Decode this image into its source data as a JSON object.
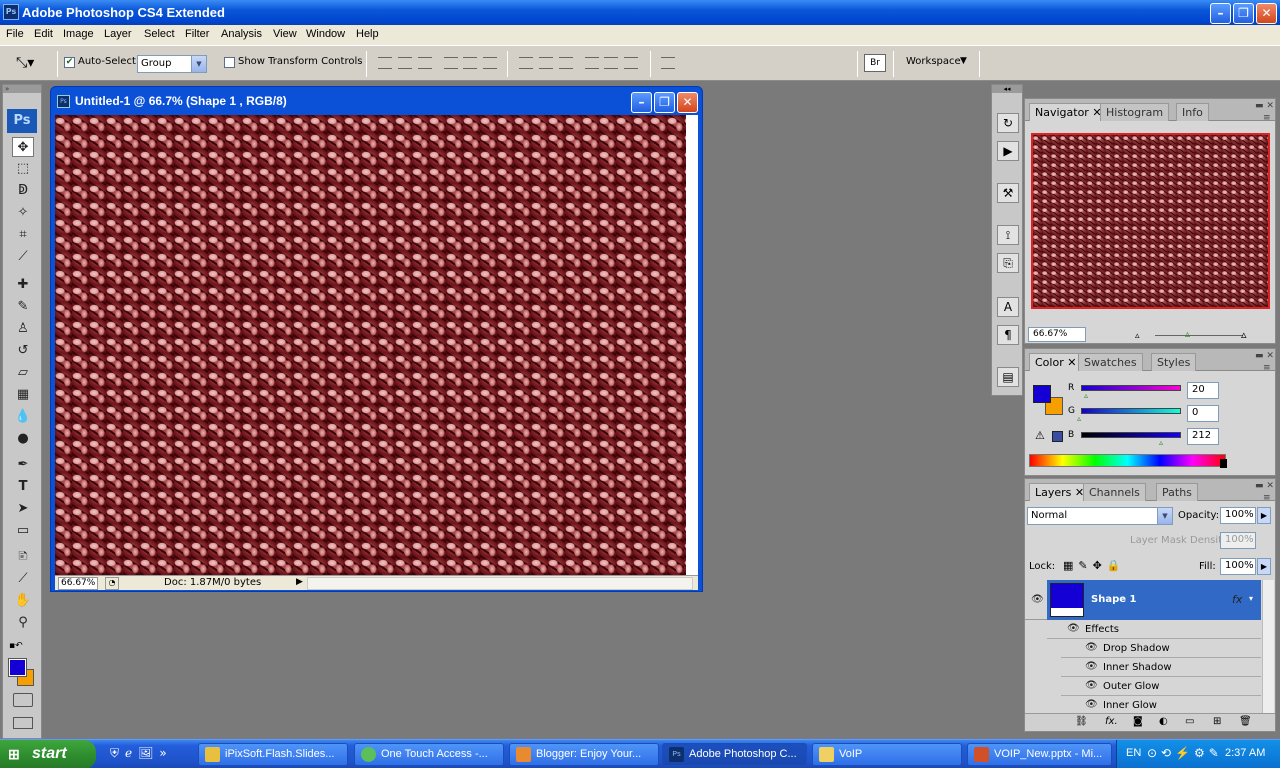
{
  "window": {
    "title": "Adobe Photoshop CS4 Extended",
    "app_icon": "Ps"
  },
  "menu": [
    "File",
    "Edit",
    "Image",
    "Layer",
    "Select",
    "Filter",
    "Analysis",
    "View",
    "Window",
    "Help"
  ],
  "options": {
    "auto_select_label": "Auto-Select:",
    "auto_select_checked": true,
    "auto_select_value": "Group",
    "transform_label": "Show Transform Controls",
    "transform_checked": false,
    "workspace_label": "Workspace"
  },
  "toolbox": {
    "logo": "Ps",
    "tools": [
      "move-tool",
      "marquee-tool",
      "lasso-tool",
      "magic-wand-tool",
      "crop-tool",
      "eyedropper-tool",
      "healing-brush-tool",
      "brush-tool",
      "clone-stamp-tool",
      "history-brush-tool",
      "eraser-tool",
      "gradient-tool",
      "blur-tool",
      "dodge-tool",
      "pen-tool",
      "type-tool",
      "path-selection-tool",
      "shape-tool",
      "notes-tool",
      "eyedropper-3d-tool",
      "hand-tool",
      "zoom-tool"
    ]
  },
  "document": {
    "title": "Untitled-1 @ 66.7% (Shape 1 , RGB/8)",
    "zoom": "66.67%",
    "doc_info": "Doc: 1.87M/0 bytes"
  },
  "navigator": {
    "tabs": [
      "Navigator",
      "Histogram",
      "Info"
    ],
    "zoom": "66.67%"
  },
  "color": {
    "tabs": [
      "Color",
      "Swatches",
      "Styles"
    ],
    "r_label": "R",
    "g_label": "G",
    "b_label": "B",
    "r": "20",
    "g": "0",
    "b": "212",
    "foreground": "#1400d4",
    "background": "#f5a000"
  },
  "layers": {
    "tabs": [
      "Layers",
      "Channels",
      "Paths"
    ],
    "blend_mode": "Normal",
    "opacity_label": "Opacity:",
    "opacity": "100%",
    "mask_density_label": "Layer Mask Density",
    "mask_density": "100%",
    "lock_label": "Lock:",
    "fill_label": "Fill:",
    "fill": "100%",
    "layer_name": "Shape 1",
    "effects_label": "Effects",
    "effects": [
      "Drop Shadow",
      "Inner Shadow",
      "Outer Glow",
      "Inner Glow"
    ]
  },
  "taskbar": {
    "start": "start",
    "tasks": [
      "iPixSoft.Flash.Slides...",
      "One Touch Access -...",
      "Blogger: Enjoy Your...",
      "Adobe Photoshop C...",
      "VoIP",
      "VOIP_New.pptx - Mi..."
    ],
    "lang": "EN",
    "time": "2:37 AM"
  }
}
